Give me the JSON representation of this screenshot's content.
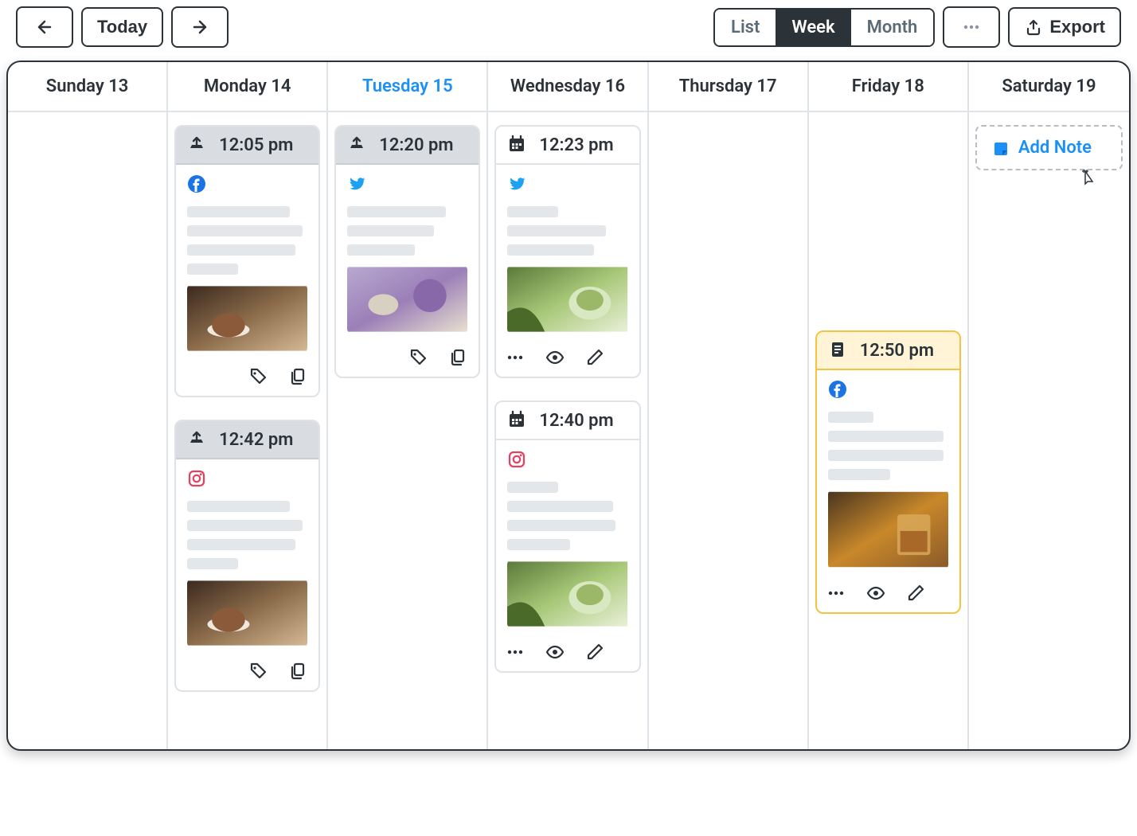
{
  "toolbar": {
    "today_label": "Today",
    "views": {
      "list": "List",
      "week": "Week",
      "month": "Month",
      "active": "week"
    },
    "export_label": "Export"
  },
  "days": [
    {
      "label": "Sunday 13",
      "today": false
    },
    {
      "label": "Monday 14",
      "today": false
    },
    {
      "label": "Tuesday 15",
      "today": true
    },
    {
      "label": "Wednesday 16",
      "today": false
    },
    {
      "label": "Thursday 17",
      "today": false
    },
    {
      "label": "Friday 18",
      "today": false
    },
    {
      "label": "Saturday 19",
      "today": false
    }
  ],
  "add_note_label": "Add Note",
  "cards": {
    "mon1": {
      "time": "12:05 pm",
      "network": "facebook",
      "status": "sent",
      "image": "coffee"
    },
    "mon2": {
      "time": "12:42 pm",
      "network": "instagram",
      "status": "sent",
      "image": "coffee"
    },
    "tue1": {
      "time": "12:20 pm",
      "network": "twitter",
      "status": "sent",
      "image": "lilac"
    },
    "wed1": {
      "time": "12:23 pm",
      "network": "twitter",
      "status": "scheduled",
      "image": "matcha"
    },
    "wed2": {
      "time": "12:40 pm",
      "network": "instagram",
      "status": "scheduled",
      "image": "matcha"
    },
    "fri1": {
      "time": "12:50 pm",
      "network": "facebook",
      "status": "draft",
      "image": "whiskey"
    }
  }
}
